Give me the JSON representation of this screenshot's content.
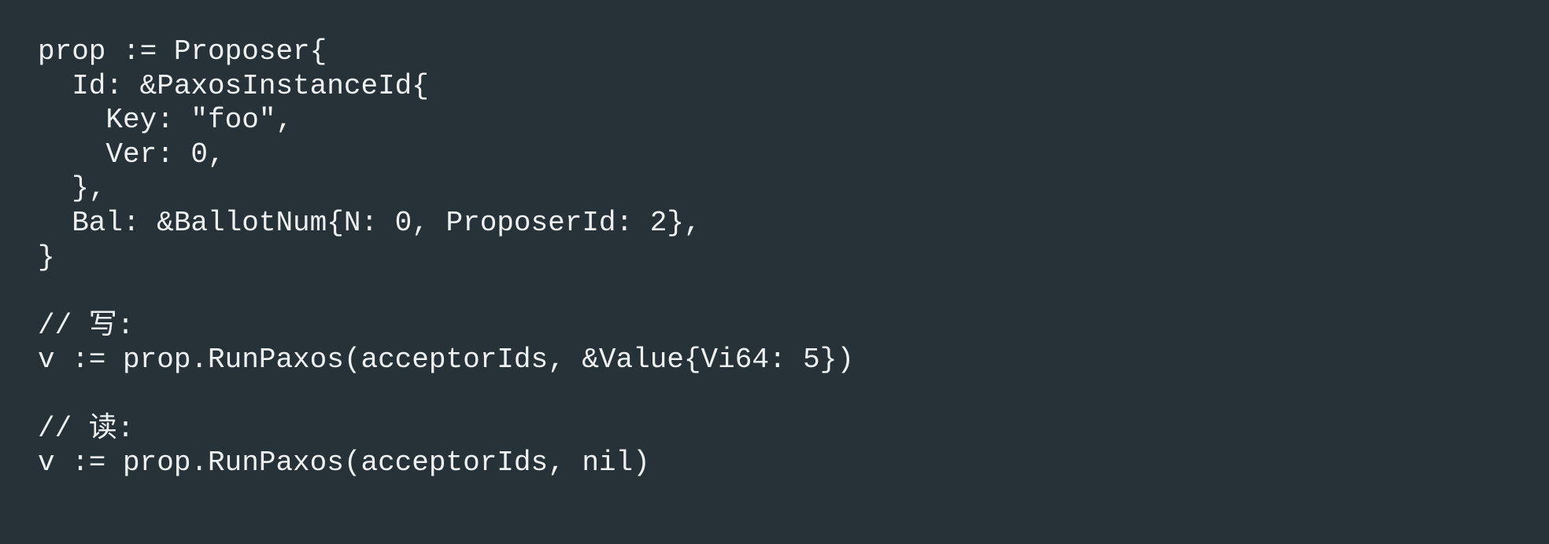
{
  "code": {
    "lines": [
      "prop := Proposer{",
      "  Id: &PaxosInstanceId{",
      "    Key: \"foo\",",
      "    Ver: 0,",
      "  },",
      "  Bal: &BallotNum{N: 0, ProposerId: 2},",
      "}",
      "",
      "// 写:",
      "v := prop.RunPaxos(acceptorIds, &Value{Vi64: 5})",
      "",
      "// 读:",
      "v := prop.RunPaxos(acceptorIds, nil)"
    ]
  },
  "theme": {
    "background": "#263238",
    "text": "#eef1f2"
  }
}
